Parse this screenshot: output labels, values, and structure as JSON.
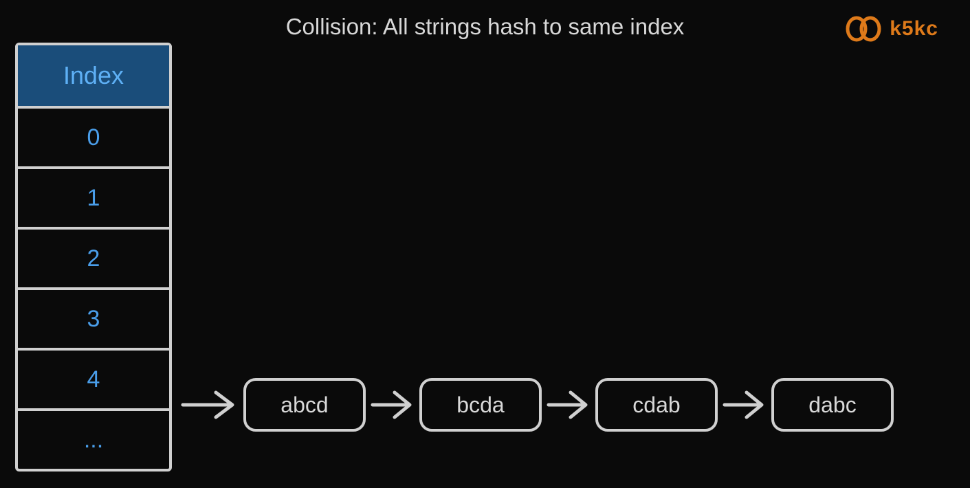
{
  "title": "Collision: All strings hash to same index",
  "brand": {
    "text": "k5kc"
  },
  "table": {
    "header": "Index",
    "rows": [
      "0",
      "1",
      "2",
      "3",
      "4",
      "..."
    ]
  },
  "chain": {
    "fromIndex": 4,
    "nodes": [
      "abcd",
      "bcda",
      "cdab",
      "dabc"
    ]
  },
  "colors": {
    "background": "#0a0a0a",
    "stroke": "#d0d0d0",
    "accentBlue": "#4a9eea",
    "headerFill": "#1a4d7a",
    "brandOrange": "#de7a1a"
  }
}
